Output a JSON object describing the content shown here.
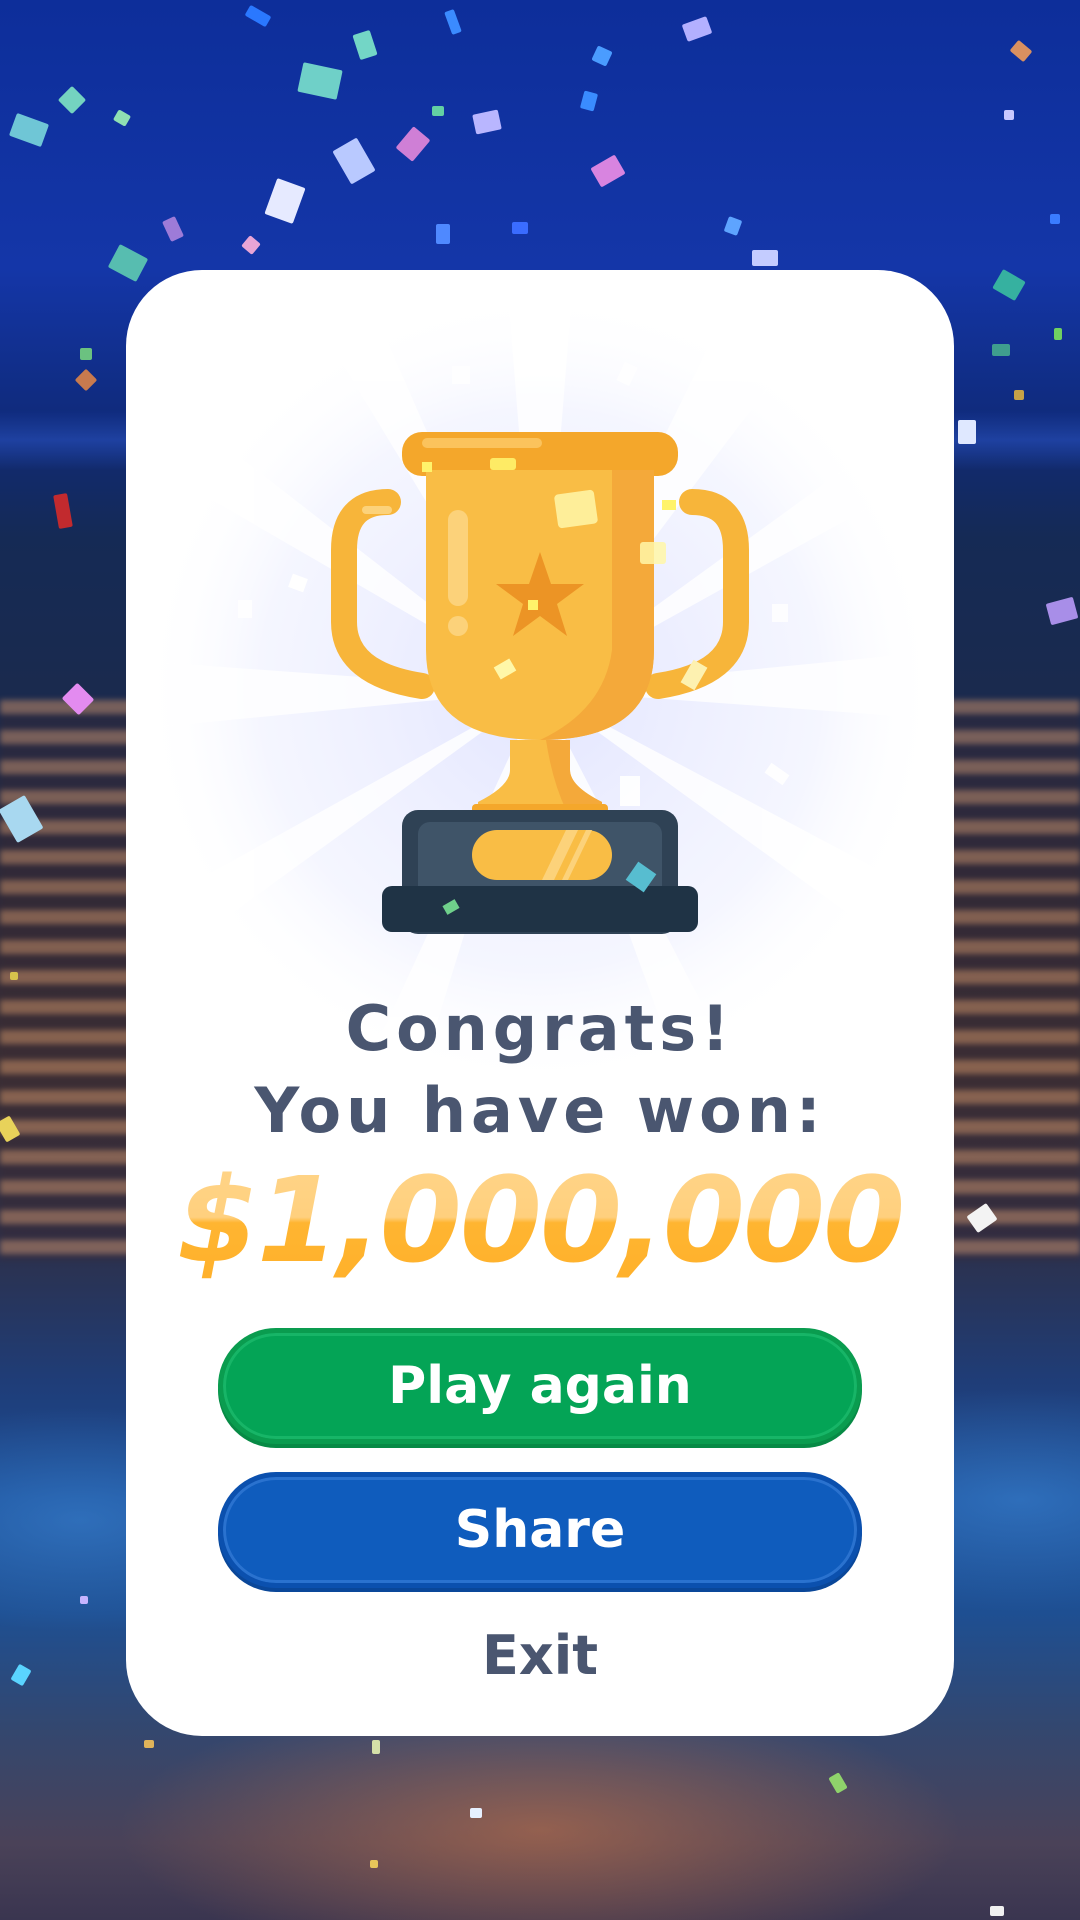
{
  "dialog": {
    "congrats_line1": "Congrats!",
    "congrats_line2": "You have won:",
    "prize_amount": "$1,000,000"
  },
  "buttons": {
    "play_again_label": "Play again",
    "share_label": "Share",
    "exit_label": "Exit"
  },
  "colors": {
    "play_again": "#04a456",
    "share": "#0f5cbd",
    "text": "#4a5670",
    "prize_gold": "#ffb637",
    "trophy_gold": "#f7b53a",
    "trophy_base": "#2f4255"
  },
  "icons": {
    "trophy": "trophy-icon",
    "star": "star-icon"
  }
}
